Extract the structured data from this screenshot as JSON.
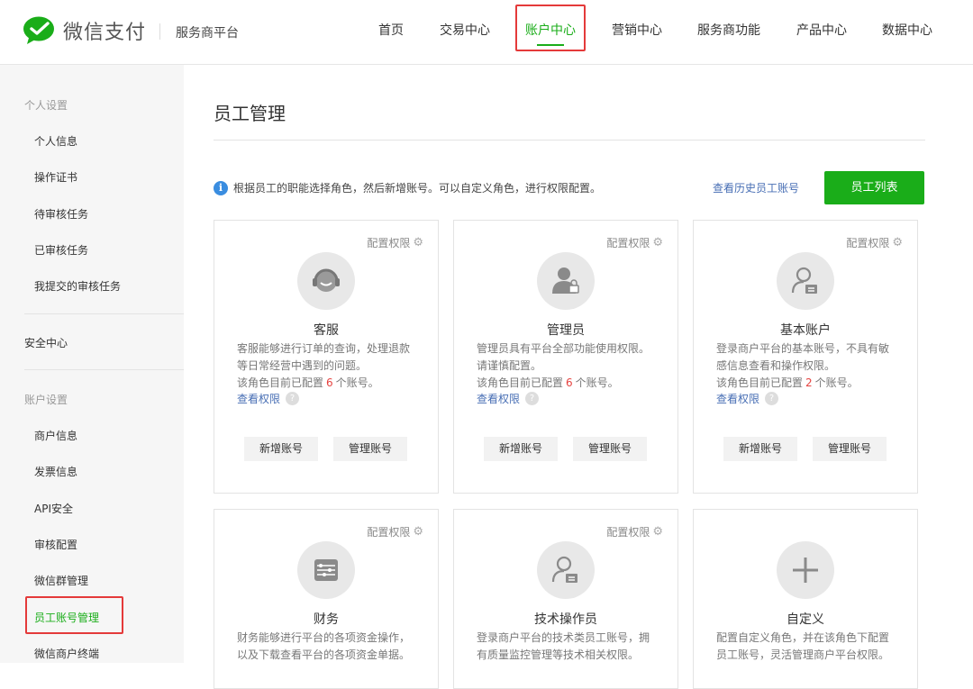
{
  "header": {
    "brand": "微信支付",
    "platform": "服务商平台",
    "nav": [
      "首页",
      "交易中心",
      "账户中心",
      "营销中心",
      "服务商功能",
      "产品中心",
      "数据中心"
    ],
    "active_nav": "账户中心"
  },
  "sidebar": {
    "group1_title": "个人设置",
    "group1_items": [
      "个人信息",
      "操作证书",
      "待审核任务",
      "已审核任务",
      "我提交的审核任务"
    ],
    "security": "安全中心",
    "group2_title": "账户设置",
    "group2_items": [
      "商户信息",
      "发票信息",
      "API安全",
      "审核配置",
      "微信群管理",
      "员工账号管理",
      "微信商户终端"
    ],
    "active_item": "员工账号管理"
  },
  "main": {
    "title": "员工管理",
    "tip": "根据员工的职能选择角色，然后新增账号。可以自定义角色，进行权限配置。",
    "history_link": "查看历史员工账号",
    "list_button": "员工列表",
    "config_label": "配置权限",
    "view_perm": "查看权限",
    "add_label": "新增账号",
    "manage_label": "管理账号",
    "count_prefix": "该角色目前已配置",
    "count_suffix": "个账号。",
    "roles": [
      {
        "name": "客服",
        "desc": "客服能够进行订单的查询，处理退款等日常经营中遇到的问题。",
        "count": "6",
        "icon": "headset-icon"
      },
      {
        "name": "管理员",
        "desc": "管理员具有平台全部功能使用权限。请谨慎配置。",
        "count": "6",
        "icon": "admin-lock-icon"
      },
      {
        "name": "基本账户",
        "desc": "登录商户平台的基本账号，不具有敏感信息查看和操作权限。",
        "count": "2",
        "icon": "basic-user-icon"
      },
      {
        "name": "财务",
        "desc": "财务能够进行平台的各项资金操作，以及下载查看平台的各项资金单据。",
        "icon": "abacus-icon"
      },
      {
        "name": "技术操作员",
        "desc": "登录商户平台的技术类员工账号，拥有质量监控管理等技术相关权限。",
        "icon": "tech-user-icon"
      },
      {
        "name": "自定义",
        "desc": "配置自定义角色，并在该角色下配置员工账号，灵活管理商户平台权限。",
        "icon": "plus-icon"
      }
    ]
  },
  "colors": {
    "accent": "#1aad19",
    "link": "#476eb4",
    "highlight_box": "#e43a3a",
    "count": "#e64340"
  }
}
